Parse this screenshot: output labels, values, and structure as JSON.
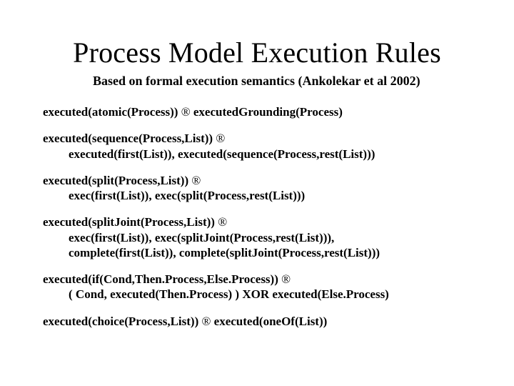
{
  "title": "Process Model Execution Rules",
  "subtitle": "Based on formal execution semantics (Ankolekar et al 2002)",
  "arrow": "®",
  "rules": {
    "r1_head": "executed(atomic(Process)) ",
    "r1_tail": " executedGrounding(Process)",
    "r2_head": "executed(sequence(Process,List)) ",
    "r2_body": "executed(first(List)), executed(sequence(Process,rest(List)))",
    "r3_head": "executed(split(Process,List)) ",
    "r3_body": "exec(first(List)), exec(split(Process,rest(List)))",
    "r4_head": "executed(splitJoint(Process,List)) ",
    "r4_body1": "exec(first(List)), exec(splitJoint(Process,rest(List))),",
    "r4_body2": "complete(first(List)), complete(splitJoint(Process,rest(List)))",
    "r5_head": "executed(if(Cond,Then.Process,Else.Process)) ",
    "r5_body": "( Cond, executed(Then.Process) )  XOR executed(Else.Process)",
    "r6_head": "executed(choice(Process,List)) ",
    "r6_tail": " executed(oneOf(List))"
  }
}
